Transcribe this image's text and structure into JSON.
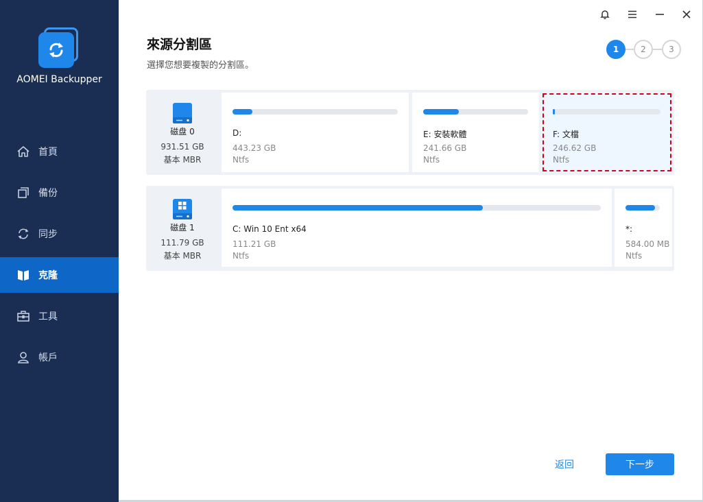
{
  "app": {
    "name": "AOMEI Backupper",
    "accent": "#1f87ea",
    "sidebar_bg": "#1a2d52",
    "active_nav_bg": "#0e67c7",
    "selection_outline": "#d0021b"
  },
  "window_controls": [
    {
      "icon": "bell-icon"
    },
    {
      "icon": "menu-icon"
    },
    {
      "icon": "minimize-icon"
    },
    {
      "icon": "close-icon"
    }
  ],
  "sidebar": {
    "items": [
      {
        "label": "首頁",
        "icon": "home-icon",
        "active": false
      },
      {
        "label": "備份",
        "icon": "backup-icon",
        "active": false
      },
      {
        "label": "同步",
        "icon": "sync-icon",
        "active": false
      },
      {
        "label": "克隆",
        "icon": "clone-icon",
        "active": true
      },
      {
        "label": "工具",
        "icon": "toolbox-icon",
        "active": false
      },
      {
        "label": "帳戶",
        "icon": "user-icon",
        "active": false
      }
    ]
  },
  "header": {
    "title": "來源分割區",
    "subtitle": "選擇您想要複製的分割區。"
  },
  "steps": [
    {
      "label": "1",
      "active": true
    },
    {
      "label": "2",
      "active": false
    },
    {
      "label": "3",
      "active": false
    }
  ],
  "disks": [
    {
      "name": "磁盘 0",
      "size": "931.51 GB",
      "type": "基本 MBR",
      "partitions": [
        {
          "label": "D:",
          "size": "443.23 GB",
          "fs": "Ntfs",
          "used_fraction": 0.12,
          "selected": false
        },
        {
          "label": "E: 安裝軟體",
          "size": "241.66 GB",
          "fs": "Ntfs",
          "used_fraction": 0.34,
          "selected": false
        },
        {
          "label": "F: 文檔",
          "size": "246.62 GB",
          "fs": "Ntfs",
          "used_fraction": 0.02,
          "selected": true
        }
      ]
    },
    {
      "name": "磁盘 1",
      "size": "111.79 GB",
      "type": "基本 MBR",
      "partitions": [
        {
          "label": "C: Win 10 Ent x64",
          "size": "111.21 GB",
          "fs": "Ntfs",
          "used_fraction": 0.68,
          "selected": false
        },
        {
          "label": "*:",
          "size": "584.00 MB",
          "fs": "Ntfs",
          "used_fraction": 0.85,
          "selected": false
        }
      ]
    }
  ],
  "footer": {
    "back_label": "返回",
    "next_label": "下一步"
  }
}
